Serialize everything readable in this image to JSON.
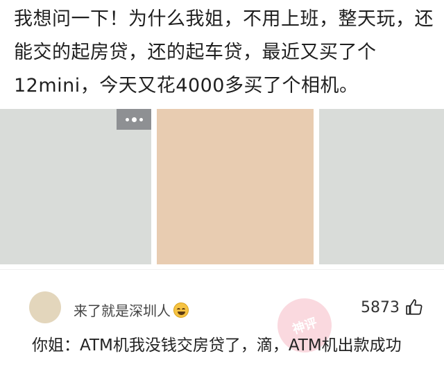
{
  "post": {
    "text": "我想问一下！为什么我姐，不用上班，整天玩，还能交的起房贷，还的起车贷，最近又买了个12mini，今天又花4000多买了个相机。"
  },
  "images": {
    "more_icon": "more-dots-icon",
    "colors": [
      "#d9dcd9",
      "#e8ccb1",
      "#d9dcd9"
    ]
  },
  "comment": {
    "username": "来了就是深圳人",
    "emoji_icon": "grinning-sweat-emoji-icon",
    "like_count": "5873",
    "like_icon": "thumbs-up-icon",
    "watermark": "神评",
    "text": "你姐：ATM机我没钱交房贷了，滴，ATM机出款成功"
  }
}
